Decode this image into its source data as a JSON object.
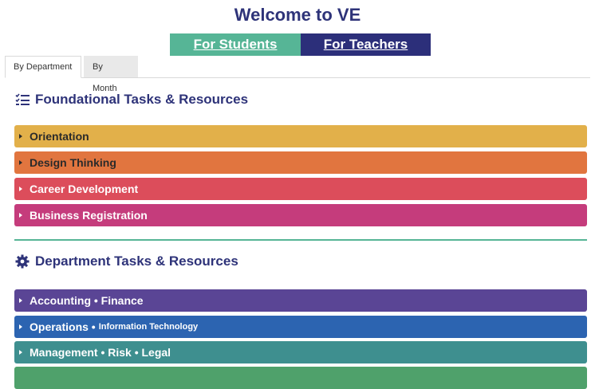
{
  "header": {
    "title": "Welcome to VE",
    "buttons": {
      "students": "For Students",
      "teachers": "For Teachers"
    }
  },
  "tabs": {
    "by_department": "By Department",
    "by_month": "By Month"
  },
  "sections": {
    "foundational": {
      "title": "Foundational Tasks & Resources",
      "items": [
        "Orientation",
        "Design Thinking",
        "Career Development",
        "Business Registration"
      ]
    },
    "department": {
      "title": "Department Tasks & Resources",
      "items": [
        {
          "main": "Accounting • Finance",
          "sub": ""
        },
        {
          "main": "Operations •",
          "sub": "Information Technology"
        },
        {
          "main": "Management • Risk • Legal",
          "sub": ""
        },
        {
          "main": "",
          "sub": ""
        }
      ]
    }
  },
  "colors": {
    "brand_navy": "#2e3379",
    "students_button": "#56b596",
    "teachers_button": "#2c2f7a",
    "orientation": "#e2b04a",
    "design_thinking": "#e1753f",
    "career_development": "#dc4d5b",
    "business_registration": "#c53c7c",
    "accounting_finance": "#5a4595",
    "operations_it": "#2c64b1",
    "management_risk_legal": "#3e8f8f",
    "next_row": "#4fa16b"
  },
  "icons": {
    "foundational": "checklist-icon",
    "department": "gear-icon",
    "row": "caret-right-icon"
  }
}
